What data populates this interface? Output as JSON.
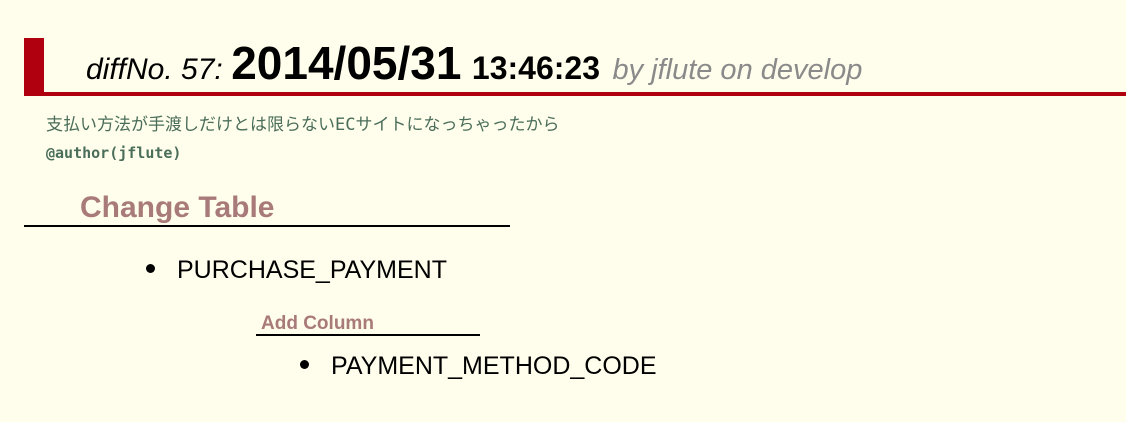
{
  "diff": {
    "label": "diffNo. 57:",
    "date": "2014/05/31",
    "time": "13:46:23",
    "by": "by jflute on develop",
    "comment": "支払い方法が手渡しだけとは限らないECサイトになっちゃったから",
    "author": "@author(jflute)"
  },
  "change_table": {
    "heading": "Change Table",
    "table_name": "PURCHASE_PAYMENT",
    "add_column": {
      "heading": "Add Column",
      "columns": [
        "PAYMENT_METHOD_CODE"
      ]
    }
  },
  "colors": {
    "accent": "#b00010",
    "heading": "#a87a7a",
    "comment": "#4a6e5a",
    "background": "#fffdeb"
  }
}
